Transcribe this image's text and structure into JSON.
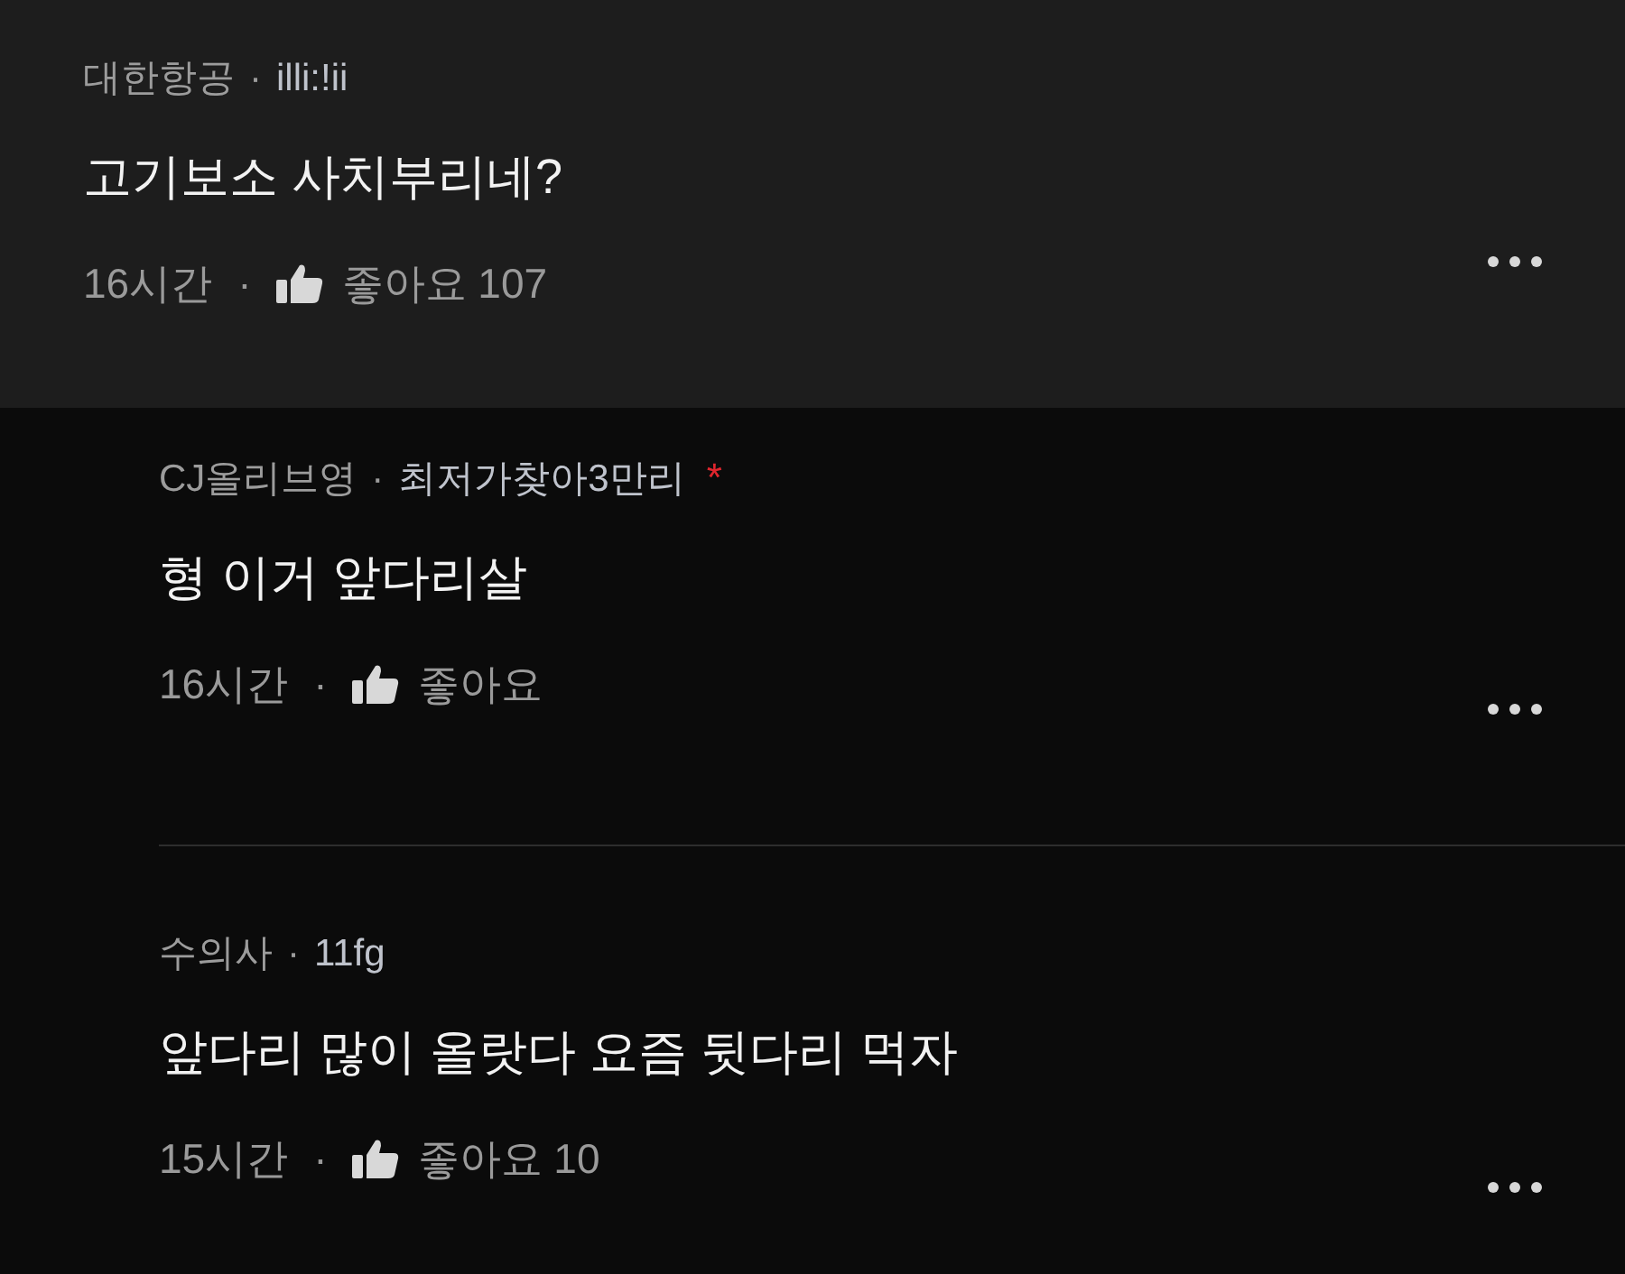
{
  "comments": [
    {
      "kind": "top",
      "company": "대한항공",
      "separator": "·",
      "nickname": "illi:!ii",
      "text": "고기보소 사치부리네?",
      "time": "16시간",
      "dot": "·",
      "likes": "좋아요 107"
    },
    {
      "kind": "reply",
      "company": "CJ올리브영",
      "separator": "·",
      "nickname": "최저가찾아3만리",
      "mark": "*",
      "text": "형 이거 앞다리살",
      "time": "16시간",
      "dot": "·",
      "likes": "좋아요"
    },
    {
      "kind": "reply",
      "company": "수의사",
      "separator": "·",
      "nickname": "11fg",
      "text": "앞다리 많이 올랏다 요즘 뒷다리 먹자",
      "time": "15시간",
      "dot": "·",
      "likes": "좋아요 10"
    }
  ]
}
